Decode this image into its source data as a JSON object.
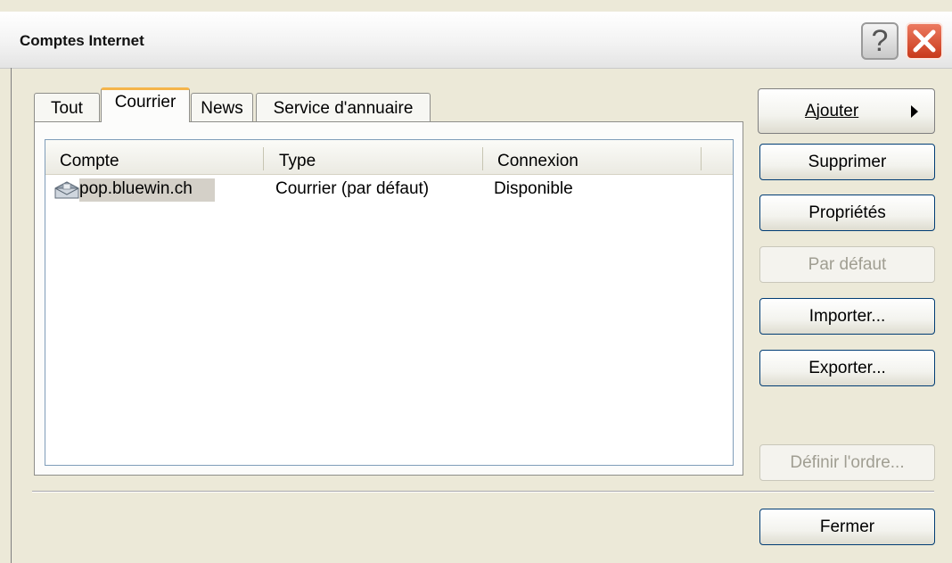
{
  "window": {
    "title": "Comptes Internet",
    "help_glyph": "?"
  },
  "tabs": [
    {
      "label": "Tout",
      "active": false
    },
    {
      "label": "Courrier",
      "active": true
    },
    {
      "label": "News",
      "active": false
    },
    {
      "label": "Service d'annuaire",
      "active": false
    }
  ],
  "list": {
    "columns": [
      "Compte",
      "Type",
      "Connexion"
    ],
    "rows": [
      {
        "compte": "pop.bluewin.ch",
        "type": "Courrier (par défaut)",
        "connexion": "Disponible",
        "icon": "mail-account-icon",
        "selected": true
      }
    ]
  },
  "buttons": {
    "ajouter": "Ajouter",
    "supprimer": "Supprimer",
    "proprietes": "Propriétés",
    "par_defaut": "Par défaut",
    "importer": "Importer...",
    "exporter": "Exporter...",
    "definir_ordre": "Définir l'ordre...",
    "fermer": "Fermer"
  },
  "colors": {
    "active_tab_accent": "#f5b54a",
    "close_button": "#c8391b",
    "selection": "#d4d0c8"
  }
}
